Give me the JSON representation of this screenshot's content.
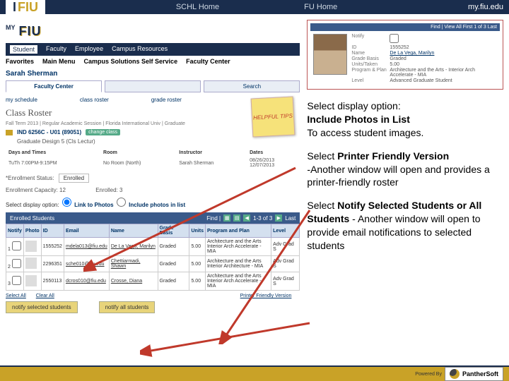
{
  "header": {
    "brand_prefix": "I",
    "brand": "FIU",
    "link1": "SCHL Home",
    "link2": "FU Home",
    "url": "my.fiu.edu"
  },
  "logo": {
    "my": "MY",
    "fiu": "FIU"
  },
  "tabs": [
    "Student",
    "Faculty",
    "Employee",
    "Campus Resources"
  ],
  "subnav": [
    "Favorites",
    "Main Menu",
    "Campus Solutions Self Service",
    "Faculty Center"
  ],
  "user": "Sarah Sherman",
  "fc_tabs": {
    "t1": "Faculty Center",
    "t2": "",
    "t3": "Search"
  },
  "links": {
    "schedule": "my schedule",
    "class_roster": "class roster",
    "grade_roster": "grade roster"
  },
  "sticky": "HELPFUL TIPS",
  "section": "Class Roster",
  "term_info": "Fall Term 2013 | Regular Academic Session | Florida International Univ | Graduate",
  "course": {
    "code": "IND 6256C - U01 (89051)",
    "change": "change class"
  },
  "course_detail": "Graduate Design 5 (Cls Lectur)",
  "meeting": {
    "headers": [
      "Days and Times",
      "Room",
      "Instructor",
      "Dates"
    ],
    "row": [
      "TuTh 7:00PM-9:15PM",
      "No Room (North)",
      "Sarah Sherman",
      "08/26/2013\n12/07/2013"
    ]
  },
  "enroll": {
    "status_lbl": "*Enrollment Status:",
    "status_val": "Enrolled",
    "cap_lbl": "Enrollment Capacity:",
    "cap_val": "12",
    "enr_lbl": "Enrolled:",
    "enr_val": "3"
  },
  "display": {
    "lbl": "Select display option:",
    "opt1": "Link to Photos",
    "opt2": "Include photos in list"
  },
  "enrolled_bar": {
    "title": "Enrolled Students",
    "find": "Find |",
    "pager": "1-3 of 3",
    "last": "Last"
  },
  "roster": {
    "headers": [
      "Notify",
      "Photo",
      "ID",
      "Email",
      "Name",
      "Grade Basis",
      "Units",
      "Program and Plan",
      "Level"
    ],
    "rows": [
      {
        "id": "1555252",
        "email": "mdela013@fiu.edu",
        "name": "De La Vega, Marilyn",
        "basis": "Graded",
        "units": "5.00",
        "program": "Architecture and the Arts\nInterior Arch Accelerate - MIA",
        "level": "Adv Grad S"
      },
      {
        "id": "2296351",
        "email": "sche010@fiu.edu",
        "name": "Chettiarmadi, Shawn",
        "basis": "Graded",
        "units": "5.00",
        "program": "Architecture and the Arts\nInterior Architecture - MIA",
        "level": "Adv Grad S"
      },
      {
        "id": "2550113",
        "email": "dcros010@fiu.edu",
        "name": "Crosse, Diana",
        "basis": "Graded",
        "units": "5.00",
        "program": "Architecture and the Arts\nInterior Arch Accelerate - MIA",
        "level": "Adv Grad S"
      }
    ]
  },
  "bottom_links": {
    "select_all": "Select All",
    "clear_all": "Clear All",
    "pfv": "Printer Friendly Version"
  },
  "actions": {
    "notify_sel": "notify selected students",
    "notify_all": "notify all students"
  },
  "student_card": {
    "header_l": "",
    "header_r": "Find | View All   First 1 of 3 Last",
    "fields": {
      "notify_lbl": "Notify",
      "notify_val": "",
      "id_lbl": "ID",
      "id_val": "1555252",
      "name_lbl": "Name",
      "name_val": "De La Vega, Marilyn",
      "basis_lbl": "Grade Basis",
      "basis_val": "Graded",
      "units_lbl": "Units/Taken",
      "units_val": "5.00",
      "program_lbl": "Program & Plan",
      "program_val": "Architecture and the Arts - Interior Arch Accelerate - MIA",
      "level_lbl": "Level",
      "level_val": "Advanced Graduate Student"
    }
  },
  "instr1": {
    "l1": "Select display option:",
    "l2": "Include Photos in List",
    "l3": "To access student images."
  },
  "instr2": {
    "l1": "Select ",
    "b": "Printer Friendly Version",
    "l2": "-Another window will open and provides a printer-friendly roster"
  },
  "instr3": {
    "l1": "Select ",
    "b": "Notify Selected Students or All Students",
    "l2": " - Another window will open to provide email notifications to selected students"
  },
  "footer": {
    "powered": "Powered By",
    "logo": "PantherSoft"
  }
}
